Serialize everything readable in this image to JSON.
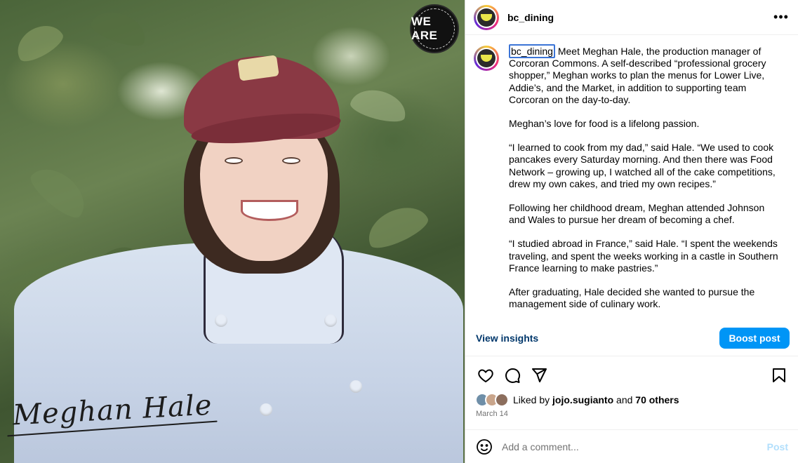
{
  "photo": {
    "signature_text": "Meghan Hale",
    "badge": {
      "main_text": "WE ARE",
      "ring_text": "Boston College Dining Services"
    }
  },
  "header": {
    "username": "bc_dining",
    "more_icon": "more-horizontal-icon"
  },
  "caption": {
    "username": "bc_dining",
    "paragraphs": [
      "Meet Meghan Hale, the production manager of Corcoran Commons. A self-described “professional grocery shopper,” Meghan works to plan the menus for Lower Live, Addie’s, and the Market, in addition to supporting team Corcoran on the day-to-day.",
      "Meghan’s love for food is a lifelong passion.",
      "“I learned to cook from my dad,” said Hale. “We used to cook pancakes every Saturday morning. And then there was Food Network – growing up, I watched all of the cake competitions, drew my own cakes, and tried my own recipes.”",
      "Following her childhood dream, Meghan attended Johnson and Wales to pursue her dream of becoming a chef.",
      "“I studied abroad in France,” said Hale. “I spent the weekends traveling, and spent the weeks working in a castle in Southern France learning to make pastries.”",
      "After graduating, Hale decided she wanted to pursue the management side of culinary work."
    ]
  },
  "insights": {
    "view_label": "View insights",
    "boost_label": "Boost post"
  },
  "actions": {
    "like_icon": "heart-icon",
    "comment_icon": "comment-icon",
    "share_icon": "share-icon",
    "save_icon": "bookmark-icon"
  },
  "likes": {
    "prefix": "Liked by ",
    "first_user": "jojo.sugianto",
    "joiner": " and ",
    "others": "70 others",
    "avatar_colors": [
      "#6f8fa8",
      "#c9a58b",
      "#8c6e5d"
    ]
  },
  "date": "March 14",
  "comment": {
    "placeholder": "Add a comment...",
    "post_label": "Post"
  },
  "colors": {
    "accent": "#0095f6",
    "link": "#00376b",
    "muted": "#737373"
  }
}
